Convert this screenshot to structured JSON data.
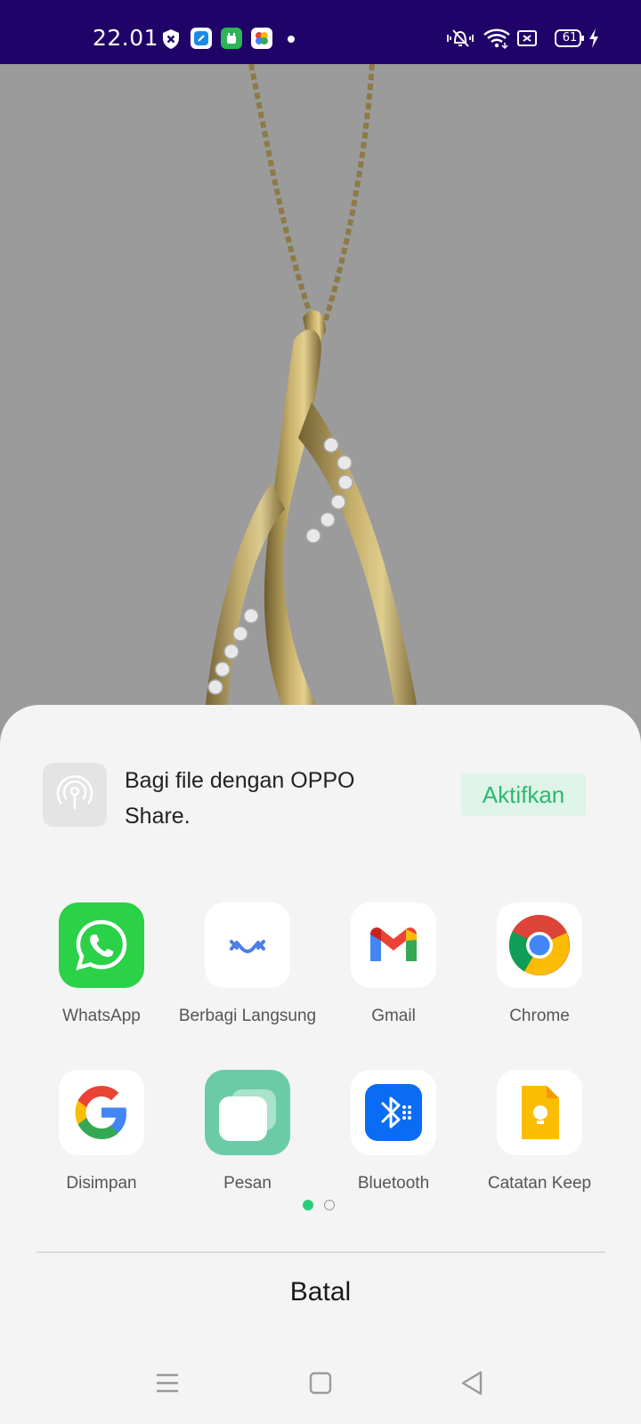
{
  "status_bar": {
    "time": "22.01",
    "battery": "61",
    "notification_icons": [
      "shield-x-icon",
      "blue-app-icon",
      "green-app-icon",
      "photos-app-icon",
      "dot-icon"
    ],
    "system_icons": [
      "vibrate-icon",
      "wifi-icon",
      "screen-cast-icon",
      "battery-icon",
      "charging-icon"
    ],
    "background_color": "#1f0368"
  },
  "share_sheet": {
    "oppo_share": {
      "text": "Bagi file dengan OPPO Share.",
      "button_label": "Aktifkan",
      "icon": "oppo-share-icon"
    },
    "apps": [
      {
        "label": "WhatsApp",
        "icon": "whatsapp-icon"
      },
      {
        "label": "Berbagi Langsung",
        "icon": "nearby-share-icon"
      },
      {
        "label": "Gmail",
        "icon": "gmail-icon"
      },
      {
        "label": "Chrome",
        "icon": "chrome-icon"
      },
      {
        "label": "Disimpan",
        "icon": "google-icon"
      },
      {
        "label": "Pesan",
        "icon": "messages-icon"
      },
      {
        "label": "Bluetooth",
        "icon": "bluetooth-icon"
      },
      {
        "label": "Catatan Keep",
        "icon": "keep-icon"
      }
    ],
    "pagination": {
      "current_page": 1,
      "total_pages": 2
    },
    "cancel_label": "Batal"
  },
  "nav_bar": [
    "menu-icon",
    "home-icon",
    "back-icon"
  ],
  "colors": {
    "accent": "#2ccb7c",
    "accent_bg": "#def4e8"
  }
}
